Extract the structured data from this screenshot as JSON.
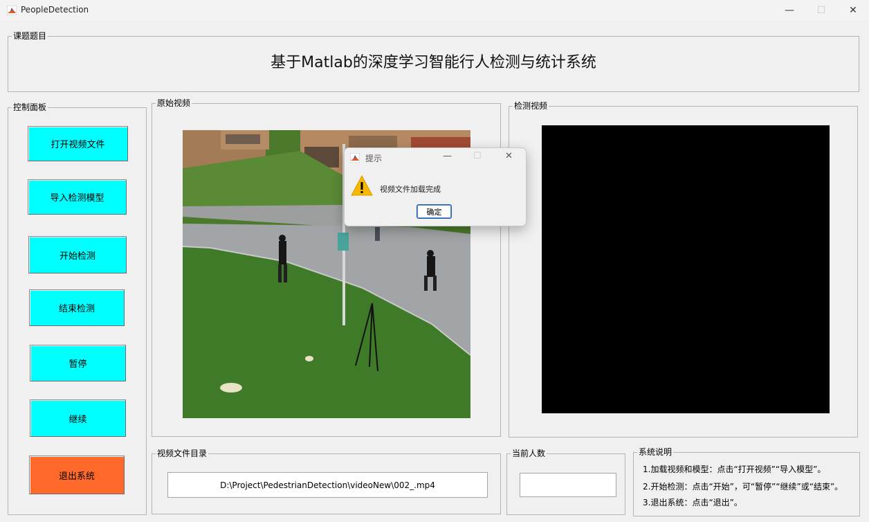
{
  "window": {
    "title": "PeopleDetection",
    "minimize_glyph": "—",
    "maximize_glyph": "☐",
    "close_glyph": "✕"
  },
  "title_panel": {
    "legend": "课题题目",
    "heading": "基于Matlab的深度学习智能行人检测与统计系统"
  },
  "control_panel": {
    "legend": "控制面板",
    "buttons": {
      "open_video": "打开视频文件",
      "load_model": "导入检测模型",
      "start": "开始检测",
      "stop": "结束检测",
      "pause": "暂停",
      "resume": "继续",
      "exit": "退出系统"
    },
    "colors": {
      "primary": "#00ffff",
      "exit": "#ff6a2b"
    }
  },
  "original_video": {
    "legend": "原始视频"
  },
  "detection_video": {
    "legend": "检测视频",
    "background": "#000000"
  },
  "file_panel": {
    "legend": "视频文件目录",
    "path": "D:\\Project\\PedestrianDetection\\videoNew\\002_.mp4"
  },
  "count_panel": {
    "legend": "当前人数",
    "value": ""
  },
  "help_panel": {
    "legend": "系统说明",
    "lines": [
      "1.加载视频和模型：点击“打开视频”“导入模型”。",
      "2.开始检测：点击“开始”，可“暂停”“继续”或“结束”。",
      "3.退出系统：点击“退出”。"
    ]
  },
  "dialog": {
    "title": "提示",
    "message": "视频文件加载完成",
    "ok": "确定",
    "icon": "warning-icon"
  }
}
